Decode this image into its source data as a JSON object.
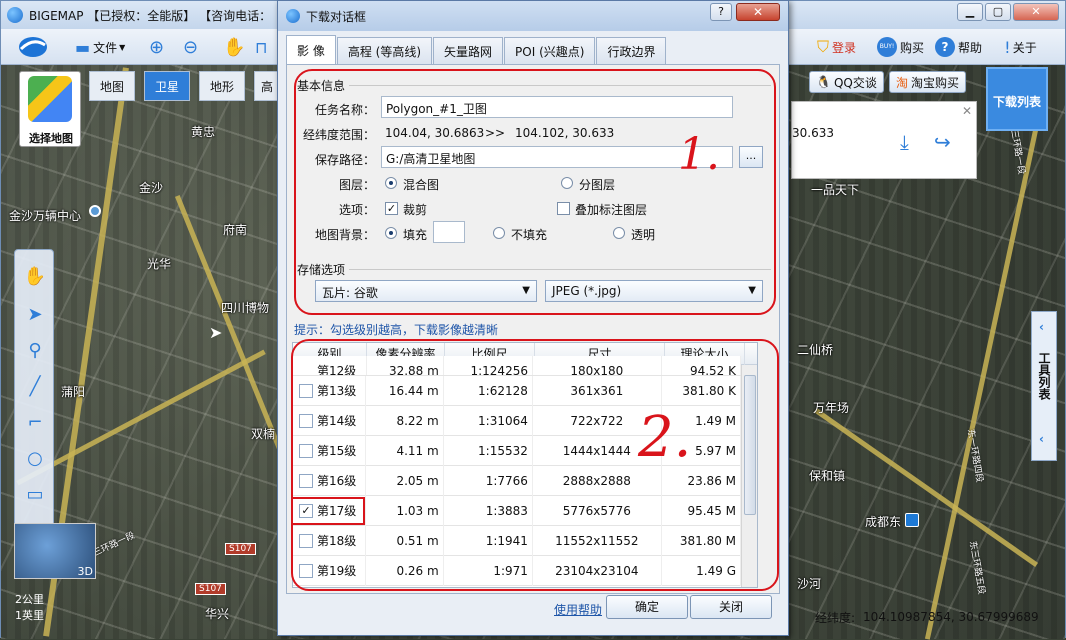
{
  "app": {
    "title": "BIGEMAP 【已授权：全能版】 【咨询电话：",
    "toolbar": {
      "file": "文件",
      "login": "登录",
      "buy_badge": "BUY!",
      "buy": "购买",
      "help": "帮助",
      "about": "关于"
    },
    "map_tabs": [
      "地图",
      "卫星",
      "地形"
    ],
    "map_tab_partial": "高",
    "map_type_label": "选择地图",
    "qq_button": "QQ交谈",
    "taobao_button": "淘宝购买",
    "download_list": "下载列表",
    "coord_partial": "30.633",
    "right_tools_label": "工具列表",
    "status_label": "经纬度:",
    "status_value": "104.10987854, 30.67999689",
    "minimap_label": "3D",
    "scale_km": "2公里",
    "scale_mi": "1英里",
    "map_labels": [
      "黄忠",
      "金沙",
      "金沙万辆中心",
      "府南",
      "光华",
      "四川博物",
      "蒲阳",
      "双楠",
      "华兴",
      "三环路一段",
      "成都东",
      "万年场",
      "保和镇",
      "东一环路四段",
      "一品天下",
      "沙河",
      "东三环路五段",
      "二仙桥",
      "东三环路一段"
    ],
    "road_shields": [
      "S107",
      "S107"
    ],
    "accent": "#2f7ed8"
  },
  "dialog": {
    "title": "下载对话框",
    "help_btn": "?",
    "close_btn": "✕",
    "tabs": [
      "影 像",
      "高程 (等高线)",
      "矢量路网",
      "POI (兴趣点)",
      "行政边界"
    ],
    "basic_info_title": "基本信息",
    "task_name_label": "任务名称：",
    "task_name": "Polygon_#1_卫图",
    "range_label": "经纬度范围：",
    "range_from": "104.04, 30.6863",
    "range_arrow": ">>",
    "range_to": "104.102, 30.633",
    "save_path_label": "保存路径：",
    "save_path": "G:/高清卫星地图",
    "browse_btn": "...",
    "layer_label": "图层：",
    "layer_mixed": "混合图",
    "layer_split": "分图层",
    "options_label": "选项：",
    "opt_crop": "裁剪",
    "opt_overlay": "叠加标注图层",
    "bg_label": "地图背景：",
    "bg_fill": "填充",
    "bg_nofill": "不填充",
    "bg_transparent": "透明",
    "storage_title": "存储选项",
    "tile_select": "瓦片: 谷歌",
    "format_select": "JPEG (*.jpg)",
    "hint": "提示：勾选级别越高，下载影像越清晰",
    "table": {
      "headers": [
        "级别",
        "像素分辨率",
        "比例尺",
        "尺寸",
        "理论大小"
      ],
      "partial_row": [
        "第12级",
        "32.88  m",
        "1:124256",
        "180x180",
        "94.52 K"
      ],
      "rows": [
        {
          "level": "第13级",
          "res": "16.44   m",
          "scale": "1:62128",
          "size": "361x361",
          "est": "381.80 K",
          "checked": false
        },
        {
          "level": "第14级",
          "res": "8.22   m",
          "scale": "1:31064",
          "size": "722x722",
          "est": "1.49 M",
          "checked": false
        },
        {
          "level": "第15级",
          "res": "4.11   m",
          "scale": "1:15532",
          "size": "1444x1444",
          "est": "5.97 M",
          "checked": false
        },
        {
          "level": "第16级",
          "res": "2.05   m",
          "scale": "1:7766",
          "size": "2888x2888",
          "est": "23.86 M",
          "checked": false
        },
        {
          "level": "第17级",
          "res": "1.03   m",
          "scale": "1:3883",
          "size": "5776x5776",
          "est": "95.45 M",
          "checked": true
        },
        {
          "level": "第18级",
          "res": "0.51   m",
          "scale": "1:1941",
          "size": "11552x11552",
          "est": "381.80 M",
          "checked": false
        },
        {
          "level": "第19级",
          "res": "0.26   m",
          "scale": "1:971",
          "size": "23104x23104",
          "est": "1.49 G",
          "checked": false
        }
      ]
    },
    "footer_help": "使用帮助",
    "ok_btn": "确定",
    "cancel_btn": "关闭",
    "annotation_1": "1.",
    "annotation_2": "2."
  }
}
